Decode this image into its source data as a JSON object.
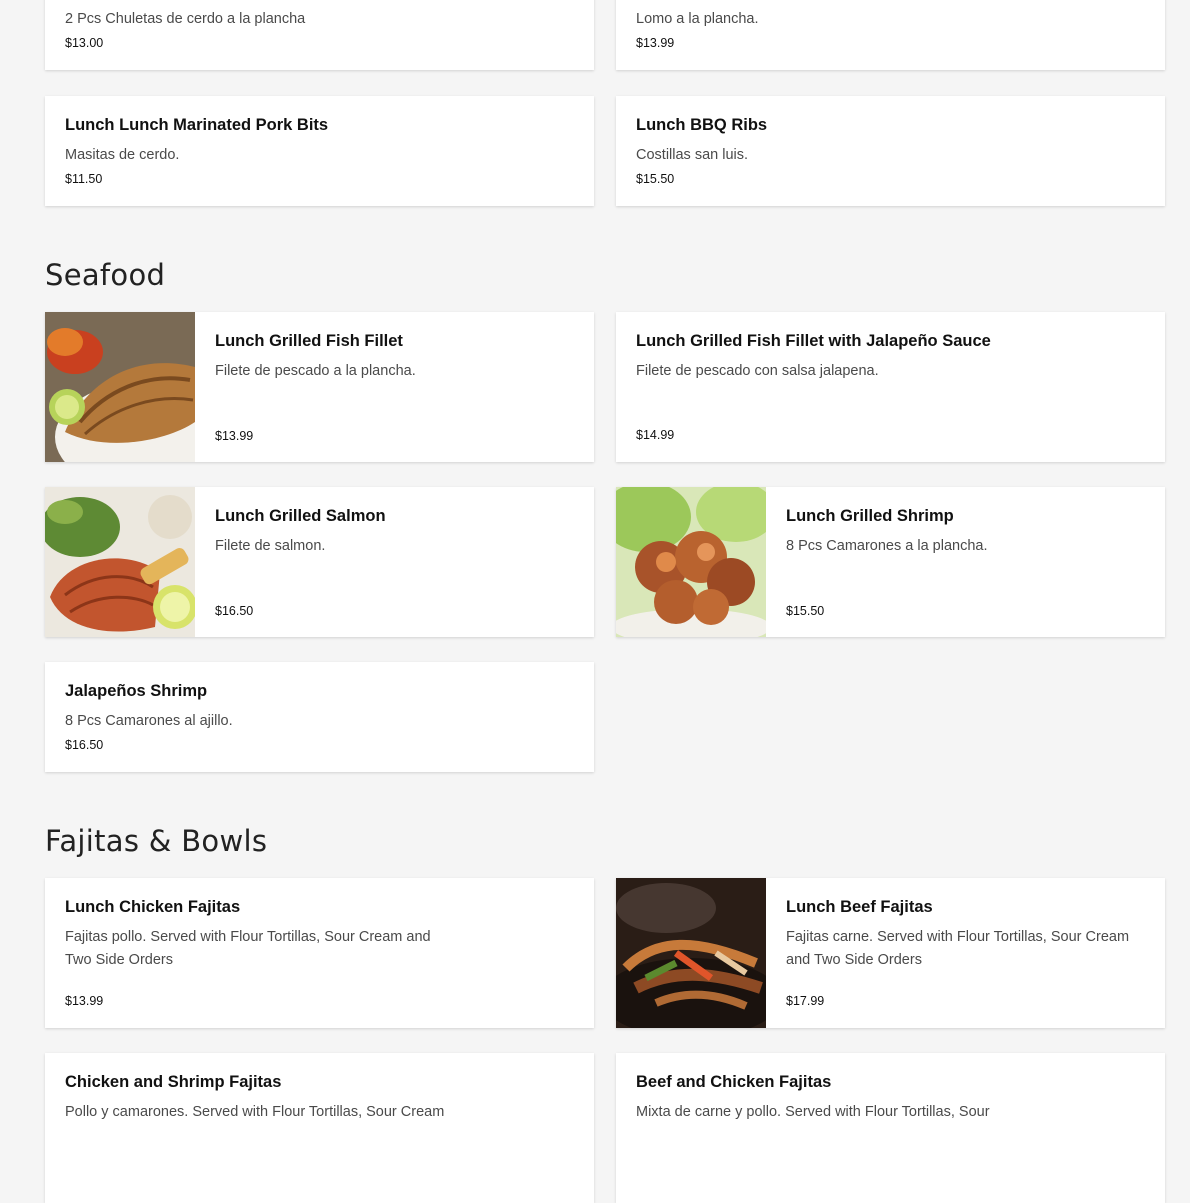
{
  "top_row": [
    {
      "desc": "2 Pcs Chuletas de cerdo a la plancha",
      "price": "$13.00"
    },
    {
      "desc": "Lomo a la plancha.",
      "price": "$13.99"
    }
  ],
  "pork_row": [
    {
      "title": "Lunch Lunch Marinated Pork Bits",
      "desc": "Masitas de cerdo.",
      "price": "$11.50"
    },
    {
      "title": "Lunch BBQ Ribs",
      "desc": "Costillas san luis.",
      "price": "$15.50"
    }
  ],
  "seafood": {
    "heading": "Seafood",
    "items": [
      {
        "title": "Lunch Grilled Fish Fillet",
        "desc": "Filete de pescado a la plancha.",
        "price": "$13.99",
        "image": "grilled-fish-fillet-photo"
      },
      {
        "title": "Lunch Grilled Fish Fillet with Jalapeño Sauce",
        "desc": "Filete de pescado con salsa jalapena.",
        "price": "$14.99"
      },
      {
        "title": "Lunch Grilled Salmon",
        "desc": "Filete de salmon.",
        "price": "$16.50",
        "image": "grilled-salmon-photo"
      },
      {
        "title": "Lunch Grilled Shrimp",
        "desc": "8 Pcs Camarones a la plancha.",
        "price": "$15.50",
        "image": "grilled-shrimp-photo"
      },
      {
        "title": "Jalapeños Shrimp",
        "desc": "8 Pcs Camarones al ajillo.",
        "price": "$16.50"
      }
    ]
  },
  "fajitas": {
    "heading": "Fajitas & Bowls",
    "items": [
      {
        "title": "Lunch Chicken Fajitas",
        "desc": "Fajitas pollo. Served with Flour Tortillas, Sour Cream and Two Side Orders",
        "price": "$13.99"
      },
      {
        "title": "Lunch Beef Fajitas",
        "desc": "Fajitas carne. Served with Flour Tortillas, Sour Cream and Two Side Orders",
        "price": "$17.99",
        "image": "beef-fajitas-photo"
      },
      {
        "title": "Chicken and Shrimp Fajitas",
        "desc": "Pollo y camarones. Served with Flour Tortillas, Sour Cream"
      },
      {
        "title": "Beef and Chicken Fajitas",
        "desc": "Mixta de carne y pollo. Served with Flour Tortillas, Sour"
      }
    ]
  }
}
